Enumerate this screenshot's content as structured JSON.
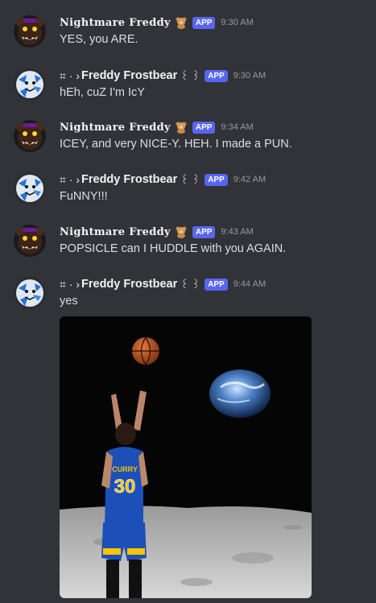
{
  "users": {
    "nightmare": {
      "name": "Nightmare Freddy",
      "badge": "APP",
      "avatar_icon": "nightmare-freddy-avatar",
      "emoji_icon": "teddy-bear-emoji"
    },
    "frostbear": {
      "prefix": "⌗ · ›",
      "name": "Freddy Frostbear",
      "deco": "꒰ ꒱",
      "badge": "APP",
      "avatar_icon": "frostbear-avatar"
    }
  },
  "messages": [
    {
      "user": "nightmare",
      "time": "9:30 AM",
      "text": "YES, you ARE."
    },
    {
      "user": "frostbear",
      "time": "9:30 AM",
      "text": "hEh, cuZ I'm IcY"
    },
    {
      "user": "nightmare",
      "time": "9:34 AM",
      "text": "ICEY, and very NICE-Y. HEH. I made a PUN."
    },
    {
      "user": "frostbear",
      "time": "9:42 AM",
      "text": "FuNNY!!!"
    },
    {
      "user": "nightmare",
      "time": "9:43 AM",
      "text": "POPSICLE can I HUDDLE with you AGAIN."
    },
    {
      "user": "frostbear",
      "time": "9:44 AM",
      "text": "yes"
    }
  ],
  "attachment": {
    "jersey_text": "CURRY",
    "jersey_number": "30"
  },
  "colors": {
    "background": "#313338",
    "app_badge": "#5865f2",
    "timestamp": "#949ba4",
    "text": "#dbdee1"
  }
}
